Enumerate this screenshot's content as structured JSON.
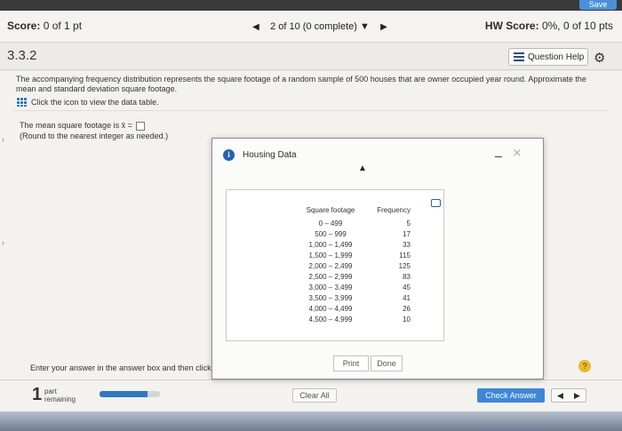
{
  "header": {
    "save_label": "Save",
    "score_label": "Score:",
    "score_value": "0 of 1 pt",
    "nav_prev": "◀",
    "progress": "2 of 10 (0 complete)",
    "progress_dropdown": "▼",
    "nav_next": "▶",
    "hw_label": "HW Score:",
    "hw_value": "0%, 0 of 10 pts"
  },
  "section": {
    "number": "3.3.2",
    "question_help_label": "Question Help",
    "gear": "⚙"
  },
  "question": {
    "prompt": "The accompanying frequency distribution represents the square footage of a random sample of 500 houses that are owner occupied year round. Approximate the mean and standard deviation square footage.",
    "table_link": "Click the icon to view the data table.",
    "mean_label": "The mean square footage is x̄ =",
    "mean_value": "",
    "round_note": "(Round to the nearest integer as needed.)",
    "enter_answer_text": "Enter your answer in the answer box and then click"
  },
  "dialog": {
    "title": "Housing Data",
    "minimize": "–",
    "close": "✕",
    "cursor": "▲",
    "columns": [
      "Square footage",
      "Frequency"
    ],
    "rows": [
      [
        "0 – 499",
        "5"
      ],
      [
        "500 – 999",
        "17"
      ],
      [
        "1,000 – 1,499",
        "33"
      ],
      [
        "1,500 – 1,999",
        "115"
      ],
      [
        "2,000 – 2,499",
        "125"
      ],
      [
        "2,500 – 2,999",
        "83"
      ],
      [
        "3,000 – 3,499",
        "45"
      ],
      [
        "3,500 – 3,999",
        "41"
      ],
      [
        "4,000 – 4,499",
        "26"
      ],
      [
        "4,500 – 4,999",
        "10"
      ]
    ],
    "print_label": "Print",
    "done_label": "Done"
  },
  "footer": {
    "parts_count": "1",
    "parts_label_1": "part",
    "parts_label_2": "remaining",
    "progress_fraction": 0.8,
    "clear_label": "Clear All",
    "check_label": "Check Answer",
    "prev": "◀",
    "next": "▶",
    "help": "?"
  },
  "colors": {
    "accent": "#2c77c7",
    "check_button": "#3d87d6",
    "help_badge": "#e8b92f"
  }
}
